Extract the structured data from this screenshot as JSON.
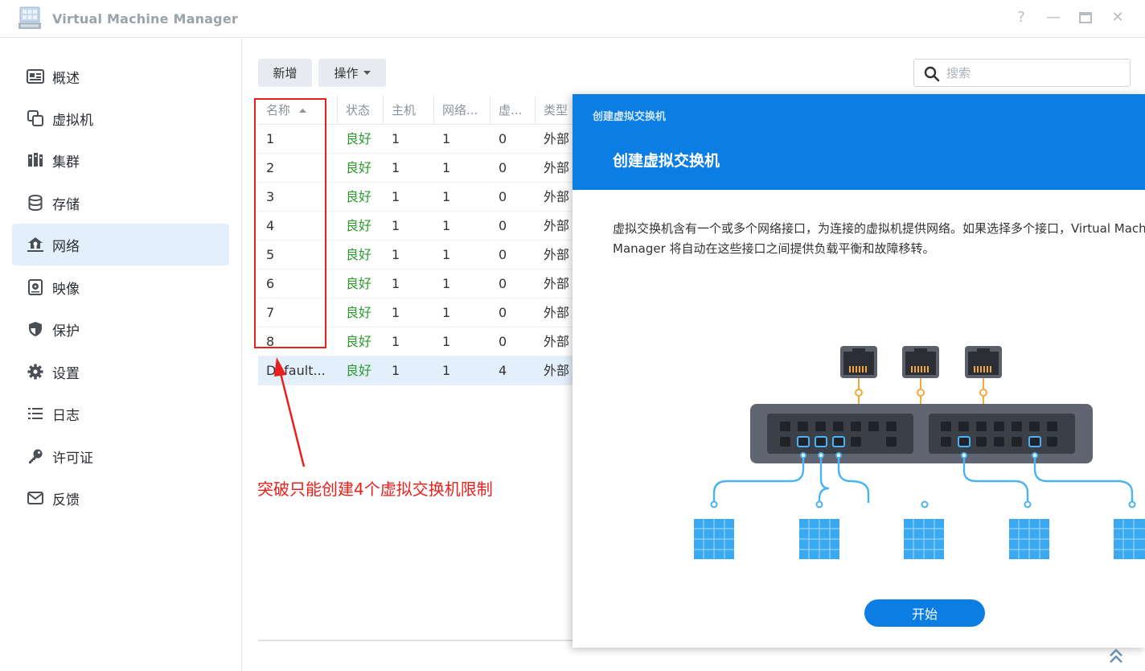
{
  "app": {
    "title": "Virtual Machine Manager",
    "icon": "vmm-app-icon",
    "window_controls": [
      "help-icon",
      "minimize-icon",
      "maximize-icon",
      "close-icon"
    ],
    "help_glyph": "?",
    "minimize_glyph": "—",
    "close_glyph": "✕"
  },
  "sidebar": {
    "items": [
      {
        "label": "概述",
        "icon": "overview-icon",
        "active": false
      },
      {
        "label": "虚拟机",
        "icon": "vm-icon",
        "active": false
      },
      {
        "label": "集群",
        "icon": "cluster-icon",
        "active": false
      },
      {
        "label": "存储",
        "icon": "storage-icon",
        "active": false
      },
      {
        "label": "网络",
        "icon": "network-icon",
        "active": true
      },
      {
        "label": "映像",
        "icon": "image-icon",
        "active": false
      },
      {
        "label": "保护",
        "icon": "shield-icon",
        "active": false
      },
      {
        "label": "设置",
        "icon": "gear-icon",
        "active": false
      },
      {
        "label": "日志",
        "icon": "log-icon",
        "active": false
      },
      {
        "label": "许可证",
        "icon": "key-icon",
        "active": false
      },
      {
        "label": "反馈",
        "icon": "mail-icon",
        "active": false
      }
    ]
  },
  "toolbar": {
    "add_label": "新增",
    "action_label": "操作",
    "search_placeholder": "搜索"
  },
  "table": {
    "columns": [
      "名称",
      "状态",
      "主机",
      "网络...",
      "虚...",
      "类型"
    ],
    "sort_column": "名称",
    "rows": [
      [
        "1",
        "良好",
        "1",
        "1",
        "0",
        "外部"
      ],
      [
        "2",
        "良好",
        "1",
        "1",
        "0",
        "外部"
      ],
      [
        "3",
        "良好",
        "1",
        "1",
        "0",
        "外部"
      ],
      [
        "4",
        "良好",
        "1",
        "1",
        "0",
        "外部"
      ],
      [
        "5",
        "良好",
        "1",
        "1",
        "0",
        "外部"
      ],
      [
        "6",
        "良好",
        "1",
        "1",
        "0",
        "外部"
      ],
      [
        "7",
        "良好",
        "1",
        "1",
        "0",
        "外部"
      ],
      [
        "8",
        "良好",
        "1",
        "1",
        "0",
        "外部"
      ],
      [
        "Default...",
        "良好",
        "1",
        "1",
        "4",
        "外部"
      ]
    ],
    "selected_row": 8
  },
  "annotation": {
    "text": "突破只能创建4个虚拟交换机限制",
    "color": "#e8201b"
  },
  "wizard": {
    "small_title": "创建虚拟交换机",
    "title": "创建虚拟交换机",
    "description_line1": "虚拟交换机含有一个或多个网络接口，为连接的虚拟机提供网络。如果选择多个接口，Virtual Machine",
    "description_line2": "Manager 将自动在这些接口之间提供负载平衡和故障移转。",
    "start_label": "开始",
    "header_color": "#0b7de3"
  },
  "colors": {
    "accent": "#0b7de3",
    "status_ok": "#2e9b2e",
    "sidebar_active": "#e3effb"
  }
}
